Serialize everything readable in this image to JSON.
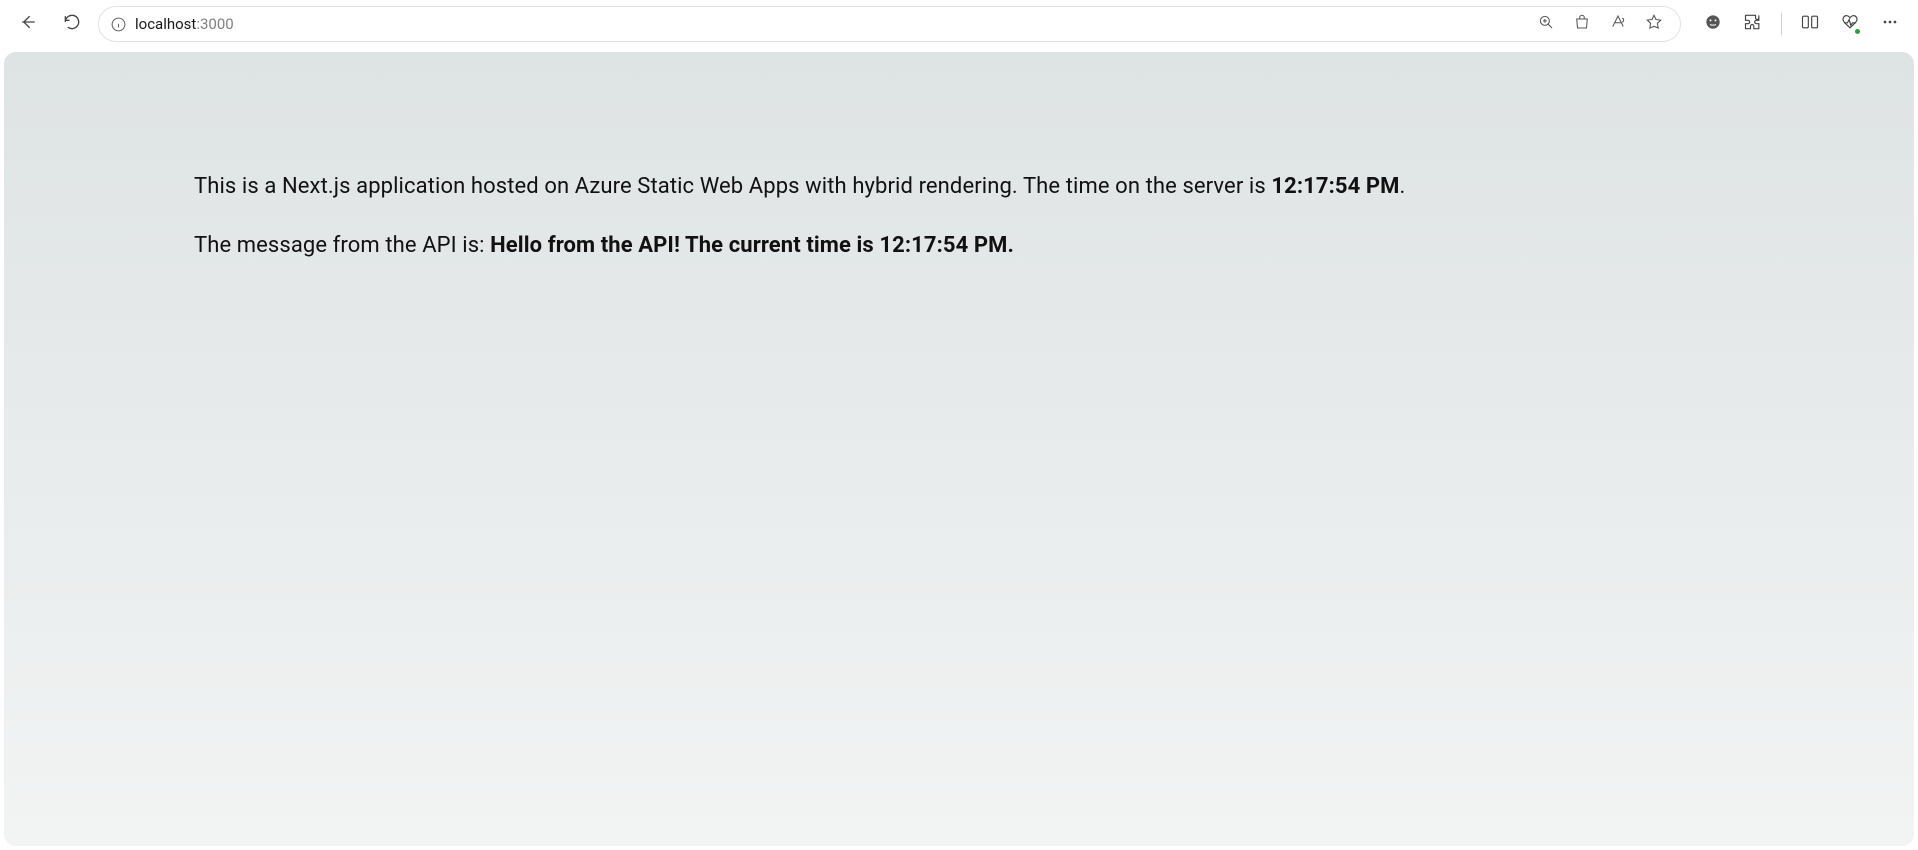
{
  "browser": {
    "address": {
      "host": "localhost",
      "port": ":3000"
    }
  },
  "page": {
    "line1_prefix": "This is a Next.js application hosted on Azure Static Web Apps with hybrid rendering. The time on the server is ",
    "line1_time": "12:17:54 PM",
    "line1_suffix": ".",
    "line2_prefix": "The message from the API is: ",
    "line2_message": "Hello from the API! The current time is 12:17:54 PM."
  }
}
